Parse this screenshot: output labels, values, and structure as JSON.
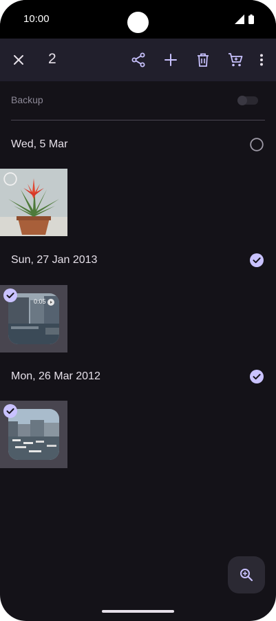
{
  "status_bar": {
    "time": "10:00"
  },
  "app_bar": {
    "selected_count": "2"
  },
  "backup": {
    "label": "Backup",
    "enabled": false
  },
  "groups": [
    {
      "date": "Wed, 5 Mar",
      "selected": false,
      "thumbs": [
        {
          "subject": "potted red bromeliad plant",
          "selected": false
        }
      ]
    },
    {
      "date": "Sun, 27 Jan 2013",
      "selected": true,
      "thumbs": [
        {
          "subject": "harbour buildings video",
          "selected": true,
          "duration": "0:05"
        }
      ]
    },
    {
      "date": "Mon, 26 Mar 2012",
      "selected": true,
      "thumbs": [
        {
          "subject": "harbour marina with boats",
          "selected": true
        }
      ]
    }
  ],
  "colors": {
    "accent": "#c9c2ff",
    "background": "#141218",
    "app_bar": "#211f2c"
  },
  "icons": [
    "close-icon",
    "share-icon",
    "add-icon",
    "delete-icon",
    "cart-icon",
    "more-vert-icon",
    "zoom-in-icon"
  ]
}
